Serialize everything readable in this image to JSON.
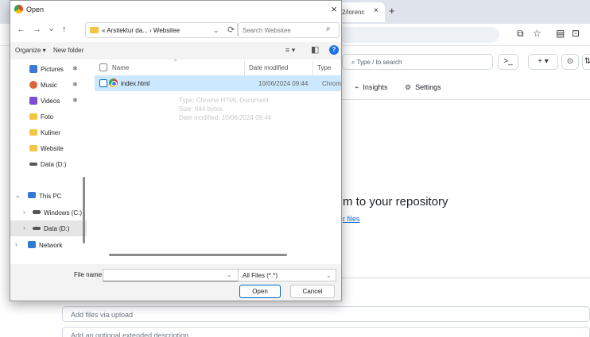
{
  "browser": {
    "tab_title": "2/lorenc",
    "tab_close": "×",
    "new_tab": "+",
    "omnibar_icons": [
      "translate-icon",
      "star-icon",
      "reading-list-icon",
      "extensions-icon"
    ],
    "search_placeholder": "Type / to search",
    "terminal_label": ">_",
    "plus_label": "+ ▾",
    "nav": [
      {
        "icon": "insights-icon",
        "label": "Insights"
      },
      {
        "icon": "gear-icon",
        "label": "Settings"
      }
    ],
    "drop_title": "m to your repository",
    "drop_link": "r files",
    "commit_title": "Add files via upload",
    "commit_desc": "Add an optional extended description..."
  },
  "dialog": {
    "title": "Open",
    "close": "×",
    "nav": {
      "back": "←",
      "forward": "→",
      "recent": "⌄",
      "up": "↑"
    },
    "address": {
      "text": "« Arsitektur da... › Websitee",
      "dropdown": "⌄",
      "refresh": "⟳"
    },
    "search": {
      "placeholder": "Search Websitee",
      "icon": "⌕"
    },
    "toolbar": {
      "organize": "Organize ▾",
      "new_folder": "New folder",
      "view_icon": "≡ ▾",
      "pane_icon": "◧",
      "help": "?"
    },
    "sidebar": {
      "items": [
        {
          "label": "Pictures",
          "icon_color": "#3b78d8",
          "pinned": true
        },
        {
          "label": "Music",
          "icon_color": "#e0623a",
          "pinned": true
        },
        {
          "label": "Videos",
          "icon_color": "#7b4ed8",
          "pinned": true
        },
        {
          "label": "Foto",
          "icon_color": "#f4c542",
          "pinned": false
        },
        {
          "label": "Kuliner",
          "icon_color": "#f4c542",
          "pinned": false
        },
        {
          "label": "Website",
          "icon_color": "#f4c542",
          "pinned": false
        },
        {
          "label": "Data (D:)",
          "icon_color": "#555555",
          "pinned": false
        },
        {
          "label": "This PC",
          "icon_color": "#2e7bd6",
          "expand": "⌄"
        },
        {
          "label": "Windows (C:)",
          "icon_color": "#555555",
          "expand": "›"
        },
        {
          "label": "Data (D:)",
          "icon_color": "#555555",
          "expand": "›",
          "selected": true
        },
        {
          "label": "Network",
          "icon_color": "#2e7bd6",
          "expand": "›"
        }
      ],
      "pin_glyph": "✱"
    },
    "columns": {
      "name": "Name",
      "date": "Date modified",
      "type": "Type"
    },
    "files": [
      {
        "name": "index.html",
        "date": "10/06/2024 09:44",
        "type": "Chrome HTML Document"
      }
    ],
    "tooltip": {
      "type": "Type: Chrome HTML Document",
      "size": "Size: 644 bytes",
      "date": "Date modified: 10/06/2024 09:44"
    },
    "footer": {
      "file_name_label": "File name:",
      "file_name_value": "",
      "file_caret": "⌄",
      "filter": "All Files (*.*)",
      "filter_caret": "⌄",
      "open": "Open",
      "cancel": "Cancel"
    }
  }
}
